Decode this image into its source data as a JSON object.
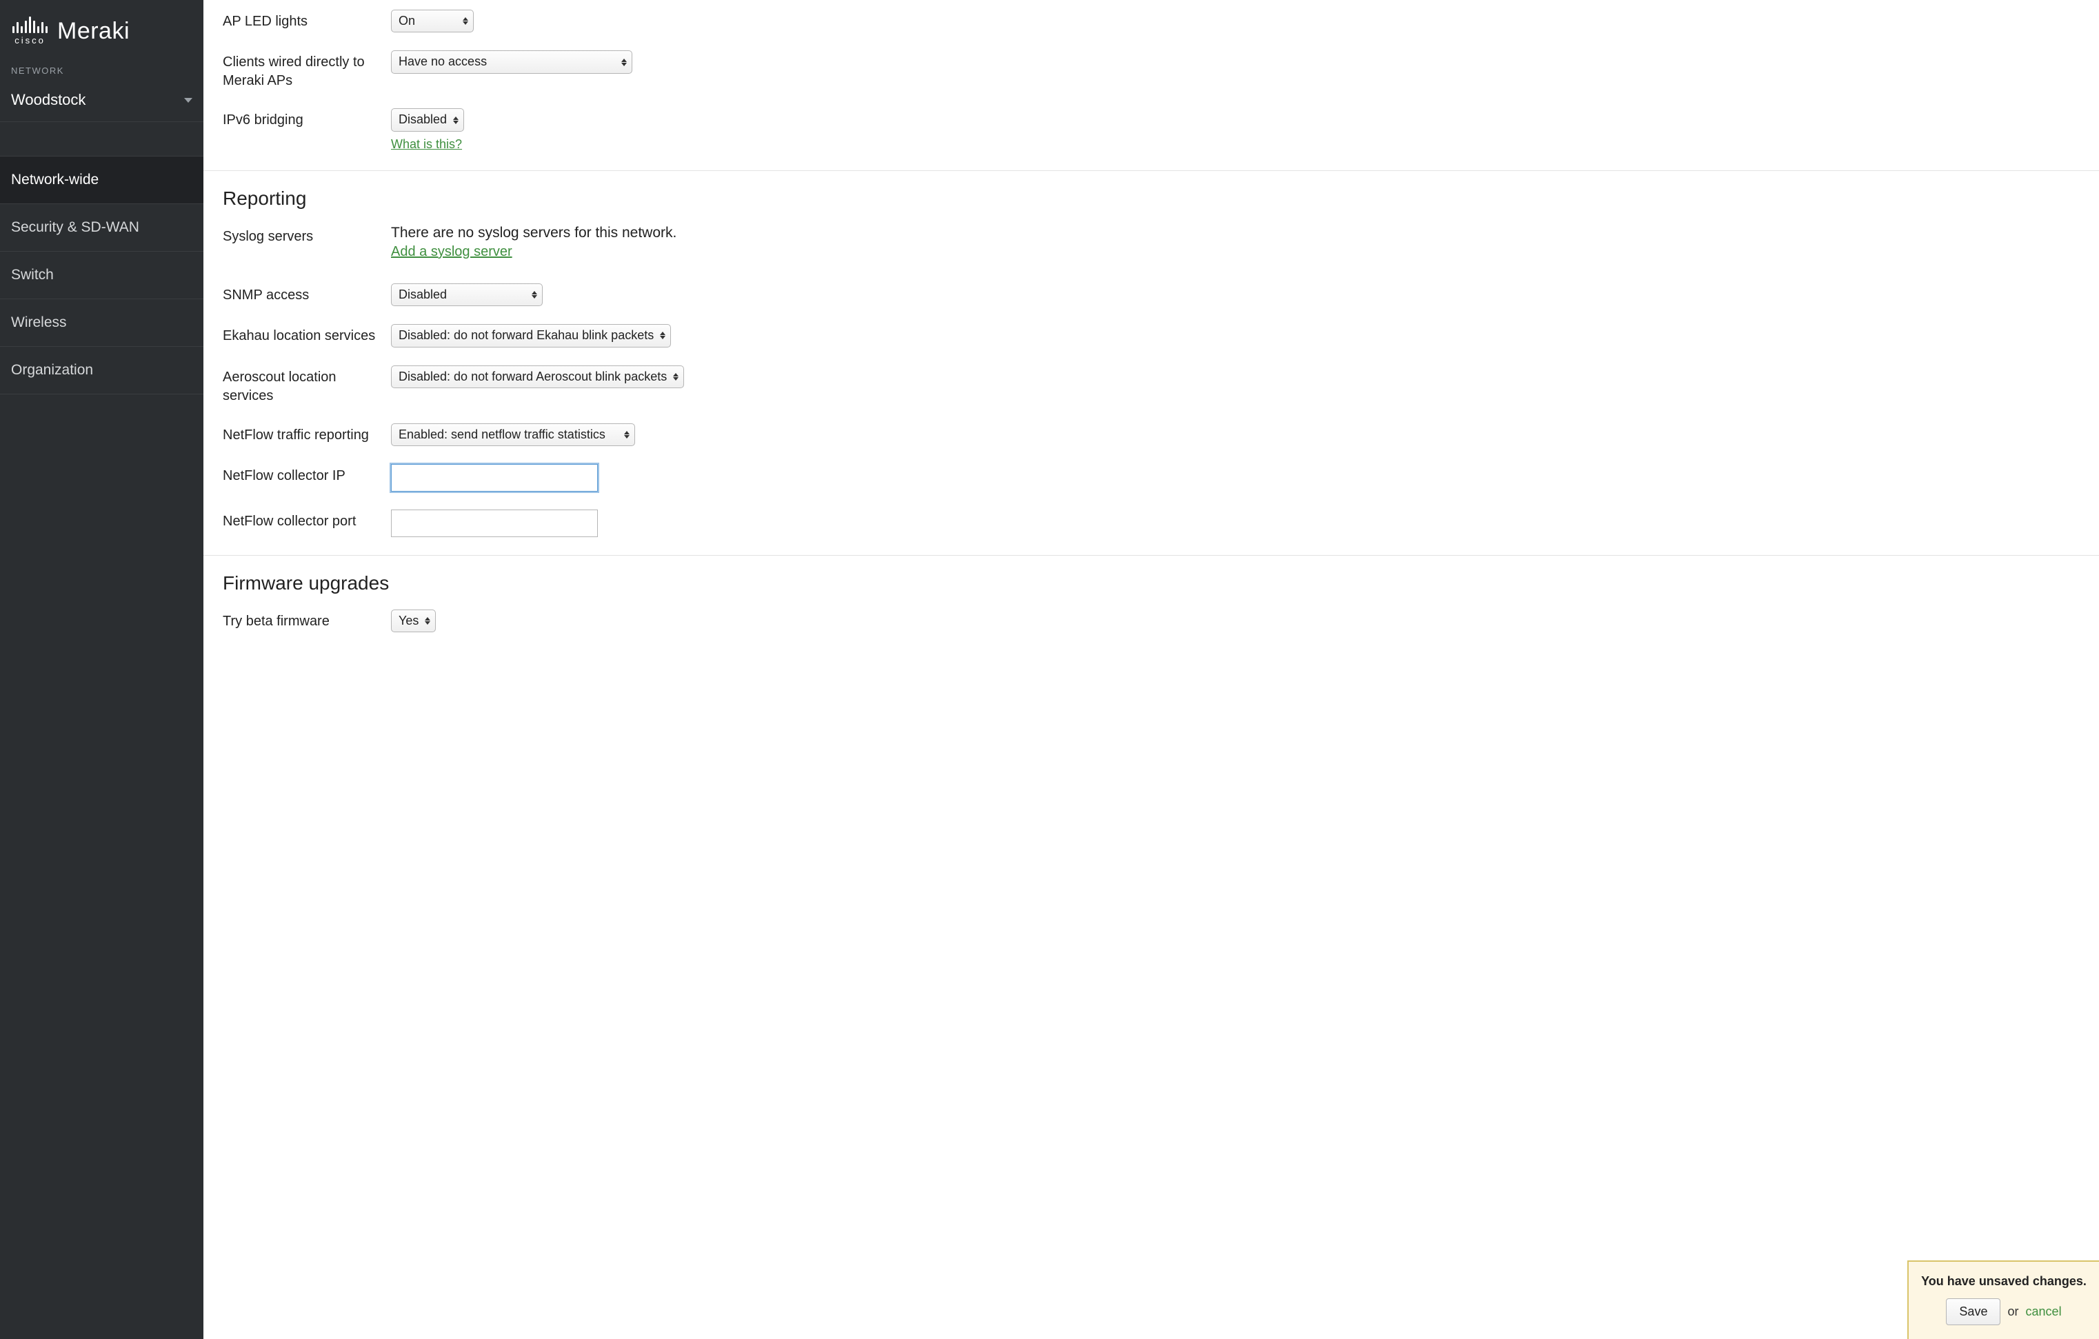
{
  "brand": {
    "cisco": "cisco",
    "meraki": "Meraki"
  },
  "sidebar": {
    "network_label": "NETWORK",
    "network_name": "Woodstock",
    "items": [
      {
        "label": "Network-wide",
        "active": true
      },
      {
        "label": "Security & SD-WAN",
        "active": false
      },
      {
        "label": "Switch",
        "active": false
      },
      {
        "label": "Wireless",
        "active": false
      },
      {
        "label": "Organization",
        "active": false
      }
    ]
  },
  "settings_top": {
    "ap_led": {
      "label": "AP LED lights",
      "value": "On"
    },
    "wired_clients": {
      "label": "Clients wired directly to Meraki APs",
      "value": "Have no access"
    },
    "ipv6": {
      "label": "IPv6 bridging",
      "value": "Disabled",
      "help": "What is this?"
    }
  },
  "reporting": {
    "title": "Reporting",
    "syslog": {
      "label": "Syslog servers",
      "status": "There are no syslog servers for this network.",
      "add_link": "Add a syslog server"
    },
    "snmp": {
      "label": "SNMP access",
      "value": "Disabled"
    },
    "ekahau": {
      "label": "Ekahau location services",
      "value": "Disabled: do not forward Ekahau blink packets"
    },
    "aeroscout": {
      "label": "Aeroscout location services",
      "value": "Disabled: do not forward Aeroscout blink packets"
    },
    "netflow": {
      "label": "NetFlow traffic reporting",
      "value": "Enabled: send netflow traffic statistics"
    },
    "netflow_ip": {
      "label": "NetFlow collector IP",
      "value": ""
    },
    "netflow_port": {
      "label": "NetFlow collector port",
      "value": ""
    }
  },
  "firmware": {
    "title": "Firmware upgrades",
    "beta": {
      "label": "Try beta firmware",
      "value": "Yes"
    }
  },
  "banner": {
    "heading": "You have unsaved changes.",
    "save": "Save",
    "or": "or",
    "cancel": "cancel"
  }
}
